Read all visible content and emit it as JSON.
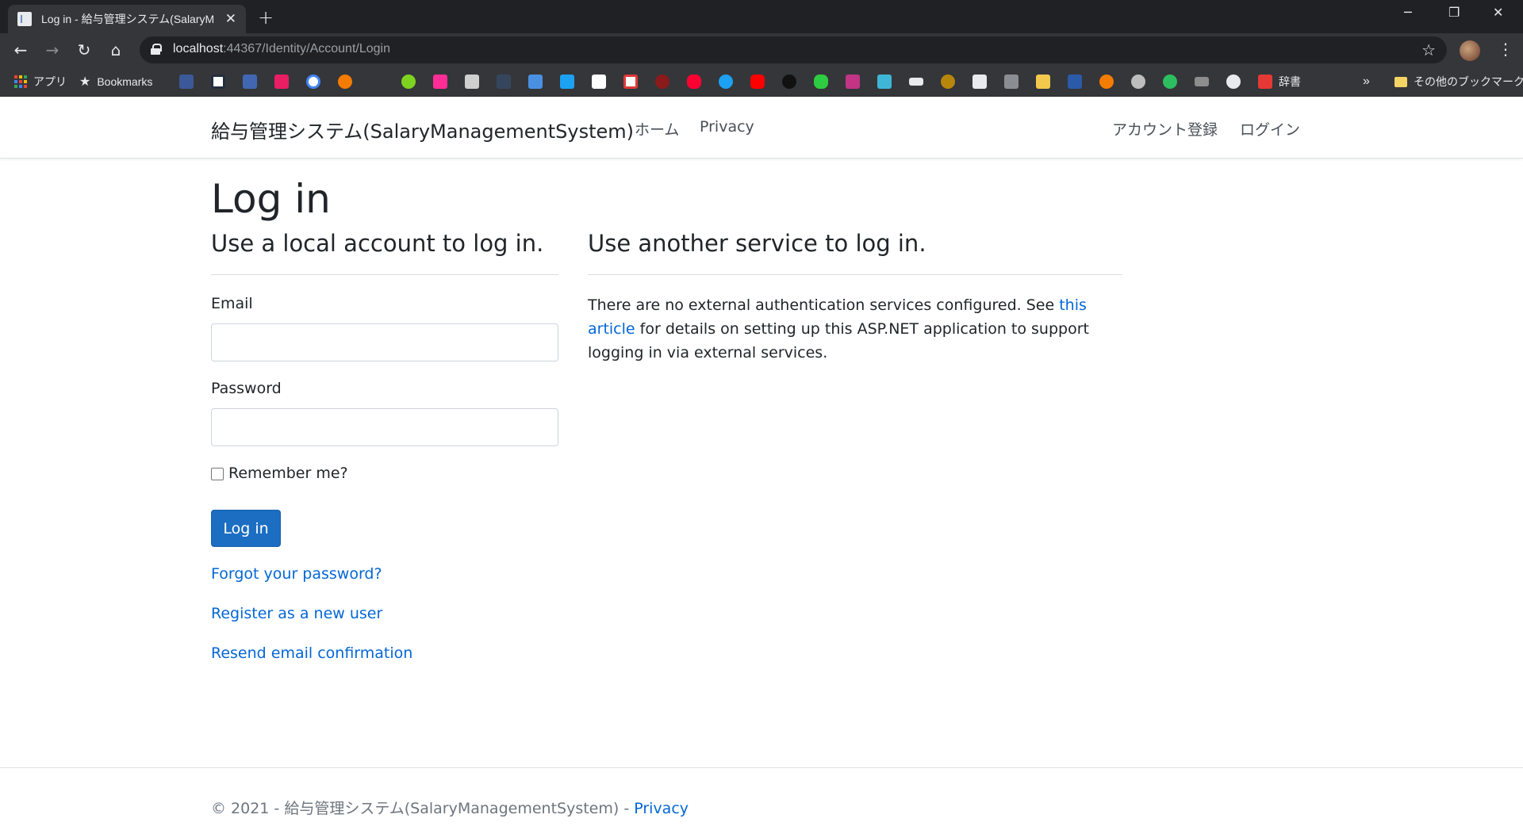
{
  "browser": {
    "tab_title": "Log in - 給与管理システム(SalaryM",
    "url_host": "localhost",
    "url_rest": ":44367/Identity/Account/Login",
    "apps_label": "アプリ",
    "bookmarks_label": "Bookmarks",
    "dictionary_label": "辞書",
    "more_label": "»",
    "other_bookmarks_label": "その他のブックマーク"
  },
  "navbar": {
    "brand": "給与管理システム(SalaryManagementSystem)",
    "home": "ホーム",
    "privacy": "Privacy",
    "register": "アカウント登録",
    "login": "ログイン"
  },
  "main": {
    "title": "Log in",
    "local": {
      "heading": "Use a local account to log in.",
      "email_label": "Email",
      "email_value": "",
      "password_label": "Password",
      "password_value": "",
      "remember_label": "Remember me?",
      "submit_label": "Log in",
      "forgot_link": "Forgot your password?",
      "register_link": "Register as a new user",
      "resend_link": "Resend email confirmation"
    },
    "external": {
      "heading": "Use another service to log in.",
      "text_before": "There are no external authentication services configured. See ",
      "link_text": "this article",
      "text_after": " for details on setting up this ASP.NET application to support logging in via external services."
    }
  },
  "footer": {
    "text": "© 2021 - 給与管理システム(SalaryManagementSystem) - ",
    "privacy": "Privacy"
  },
  "colors": {
    "primary": "#1b6ec2",
    "link": "#0366d6",
    "chrome_dark": "#202124",
    "chrome_toolbar": "#35363a"
  }
}
